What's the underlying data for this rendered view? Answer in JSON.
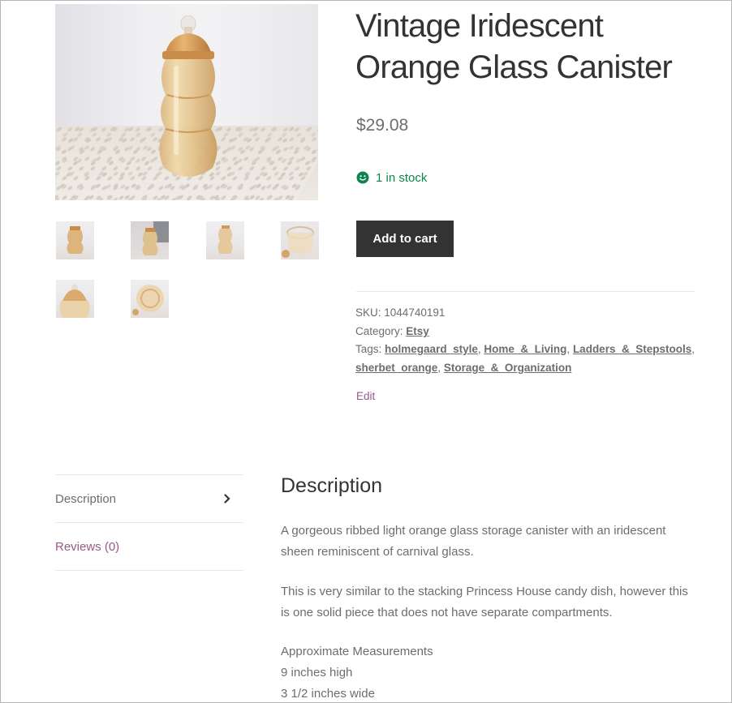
{
  "product": {
    "title": "Vintage Iridescent Orange Glass Canister",
    "price": "$29.08",
    "stock": "1 in stock",
    "add_to_cart": "Add to cart"
  },
  "meta": {
    "sku_label": "SKU:",
    "sku": "1044740191",
    "category_label": "Category:",
    "category": "Etsy",
    "tags_label": "Tags:",
    "tags": [
      "holmegaard_style",
      "Home_&_Living",
      "Ladders_&_Stepstools",
      "sherbet_orange",
      "Storage_&_Organization"
    ],
    "tag_separator": ",",
    "edit": "Edit"
  },
  "tabs": [
    {
      "label": "Description"
    },
    {
      "label": "Reviews (0)"
    }
  ],
  "description": {
    "heading": "Description",
    "paragraphs": [
      "A gorgeous ribbed light orange glass storage canister with an iridescent sheen reminiscent of carnival glass.",
      "This is very similar to the stacking Princess House candy dish, however this is one solid piece that does not have separate compartments."
    ],
    "measurements": [
      "Approximate Measurements",
      "9 inches high",
      "3 1/2 inches wide"
    ]
  },
  "colors": {
    "heading": "#333333",
    "body_text": "#6d6d6d",
    "in_stock": "#0f834d",
    "link_accent": "#96588a",
    "button_bg": "#333333"
  },
  "icons": [
    "zoom-icon",
    "smiley-icon",
    "chevron-right-icon"
  ]
}
